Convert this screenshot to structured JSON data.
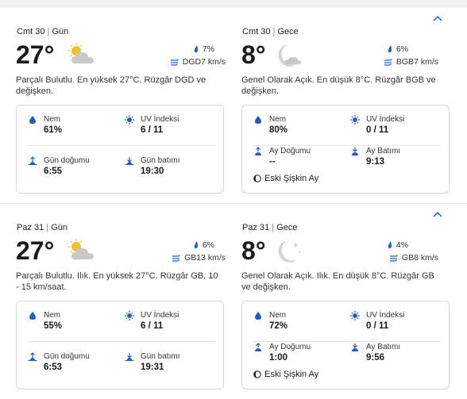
{
  "days": [
    {
      "day": {
        "date_label": "Cmt 30",
        "period": "Gün",
        "temp": "27°",
        "icon": "partly-cloudy-icon",
        "precip": "7%",
        "wind": "DGD7 km/s",
        "summary": "Parçalı Bulutlu. En yüksek 27°C. Rüzgâr DGD ve değişken.",
        "humidity_label": "Nem",
        "humidity": "61%",
        "uv_label": "UV İndeksi",
        "uv": "6 / 11",
        "sunrise_label": "Gün doğumu",
        "sunrise": "6:55",
        "sunset_label": "Gün batımı",
        "sunset": "19:30"
      },
      "night": {
        "date_label": "Cmt 30",
        "period": "Gece",
        "temp": "8°",
        "icon": "mostly-clear-night-icon",
        "precip": "6%",
        "wind": "BGB7 km/s",
        "summary": "Genel Olarak Açık. En düşük 8°C. Rüzgâr BGB ve değişken.",
        "humidity_label": "Nem",
        "humidity": "80%",
        "uv_label": "UV İndeksi",
        "uv": "0 / 11",
        "moonrise_label": "Ay Doğumu",
        "moonrise": "--",
        "moonset_label": "Ay Batımı",
        "moonset": "9:13",
        "moon_phase": "Eski Şişkin Ay"
      }
    },
    {
      "day": {
        "date_label": "Paz 31",
        "period": "Gün",
        "temp": "27°",
        "icon": "partly-cloudy-icon",
        "precip": "6%",
        "wind": "GB13 km/s",
        "summary": "Parçalı Bulutlu. Ilık. En yüksek 27°C. Rüzgâr GB, 10 - 15 km/saat.",
        "humidity_label": "Nem",
        "humidity": "55%",
        "uv_label": "UV İndeksi",
        "uv": "6 / 11",
        "sunrise_label": "Gün doğumu",
        "sunrise": "6:53",
        "sunset_label": "Gün batımı",
        "sunset": "19:31"
      },
      "night": {
        "date_label": "Paz 31",
        "period": "Gece",
        "temp": "8°",
        "icon": "clear-night-icon",
        "precip": "4%",
        "wind": "GB8 km/s",
        "summary": "Genel Olarak Açık. Ilık. En düşük 8°C. Rüzgâr GB ve değişken.",
        "humidity_label": "Nem",
        "humidity": "72%",
        "uv_label": "UV İndeksi",
        "uv": "0 / 11",
        "moonrise_label": "Ay Doğumu",
        "moonrise": "1:00",
        "moonset_label": "Ay Batımı",
        "moonset": "9:56",
        "moon_phase": "Eski Şişkin Ay"
      }
    }
  ],
  "colors": {
    "accent": "#1f5fbf",
    "sun": "#f2c12e",
    "cloud": "#c9c9c9",
    "moon": "#d4d4d4"
  }
}
